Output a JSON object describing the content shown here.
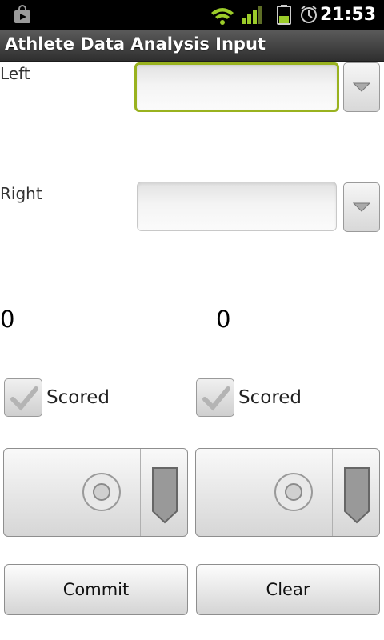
{
  "status_bar": {
    "time": "21:53",
    "icons": [
      "shopping-bag-icon",
      "wifi-icon",
      "signal-icon",
      "battery-icon",
      "alarm-clock-icon"
    ]
  },
  "app": {
    "title": "Athlete Data Analysis Input"
  },
  "left": {
    "label": "Left",
    "input_value": "",
    "count": "0",
    "checkbox_label": "Scored"
  },
  "right": {
    "label": "Right",
    "input_value": "",
    "count": "0",
    "checkbox_label": "Scored"
  },
  "buttons": {
    "commit": "Commit",
    "clear": "Clear"
  },
  "colors": {
    "focus_border": "#99b21f",
    "title_bar": "#3a3a3a",
    "status_bar": "#000000"
  }
}
